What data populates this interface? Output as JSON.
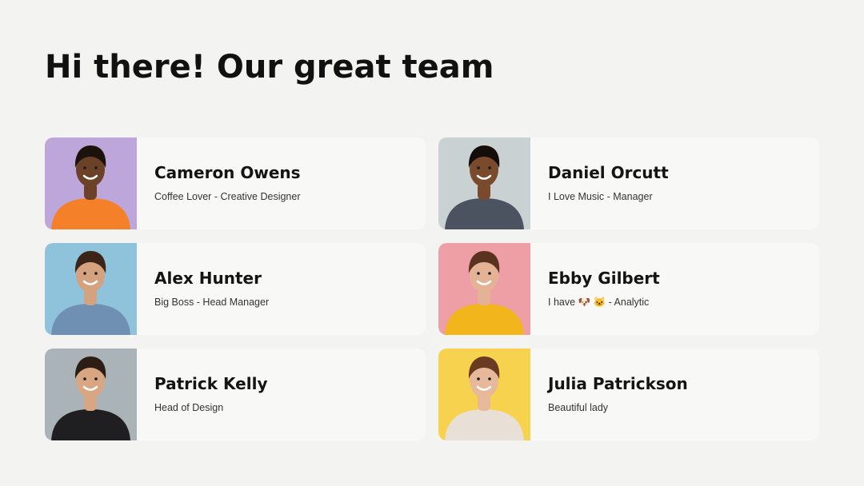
{
  "page": {
    "title": "Hi there! Our great team"
  },
  "members": [
    {
      "name": "Cameron Owens",
      "description": "Coffee Lover - Creative Designer",
      "avatar_bg": "#bda6da",
      "shirt_color": "#f4812a",
      "skin": "#6b4128",
      "hair": "#1c120c"
    },
    {
      "name": "Daniel Orcutt",
      "description": "I Love Music - Manager",
      "avatar_bg": "#c9d1d3",
      "shirt_color": "#4b5360",
      "skin": "#7a4a2d",
      "hair": "#140d09"
    },
    {
      "name": "Alex Hunter",
      "description": "Big Boss -  Head Manager",
      "avatar_bg": "#8ec3db",
      "shirt_color": "#6f8fb3",
      "skin": "#d5a27f",
      "hair": "#3a2518"
    },
    {
      "name": "Ebby Gilbert",
      "description": "I have 🐶 🐱 - Analytic",
      "avatar_bg": "#ee9fa6",
      "shirt_color": "#f2b51c",
      "skin": "#e4b396",
      "hair": "#5a3320"
    },
    {
      "name": "Patrick Kelly",
      "description": "Head of Design",
      "avatar_bg": "#a9b3b8",
      "shirt_color": "#1f1f22",
      "skin": "#d9a683",
      "hair": "#2d1e15"
    },
    {
      "name": "Julia Patrickson",
      "description": "Beautiful lady",
      "avatar_bg": "#f7d24f",
      "shirt_color": "#e8e0d6",
      "skin": "#e7b899",
      "hair": "#6a3a22"
    }
  ]
}
